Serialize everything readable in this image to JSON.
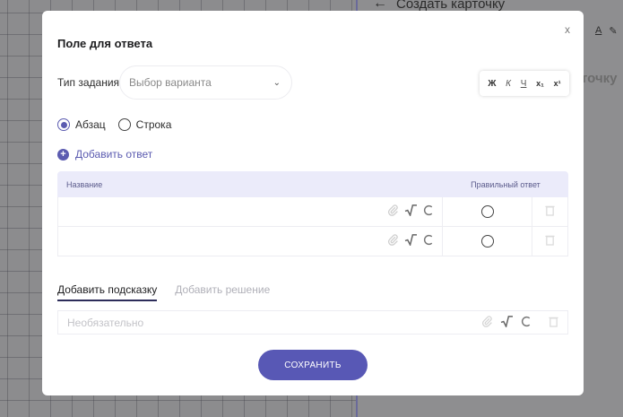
{
  "background": {
    "header_title": "Создать карточку",
    "side_text": "точку",
    "tools": [
      "А",
      "✎"
    ]
  },
  "modal": {
    "title": "Поле для ответа",
    "close_label": "x",
    "task_type_label": "Тип задания",
    "task_type_placeholder": "Выбор варианта",
    "format_toolbar": {
      "bold": "Ж",
      "italic": "К",
      "underline": "Ч",
      "subscript": "x₁",
      "superscript": "x¹"
    },
    "radio_options": [
      {
        "label": "Абзац",
        "checked": true
      },
      {
        "label": "Строка",
        "checked": false
      }
    ],
    "add_answer_label": "Добавить ответ",
    "table": {
      "col_name": "Название",
      "col_correct": "Правильный ответ",
      "rows": [
        {
          "name": "",
          "correct": false
        },
        {
          "name": "",
          "correct": false
        }
      ]
    },
    "tabs": [
      {
        "label": "Добавить подсказку",
        "active": true
      },
      {
        "label": "Добавить решение",
        "active": false
      }
    ],
    "hint_placeholder": "Необязательно",
    "save_label": "СОХРАНИТЬ"
  },
  "colors": {
    "accent": "#5858b5",
    "table_header_bg": "#ebebfa",
    "overlay": "#8c8c8e"
  },
  "icons": [
    "close-icon",
    "chevron-down-icon",
    "plus-icon",
    "attach-icon",
    "sqrt-icon",
    "refresh-icon",
    "trash-icon",
    "back-arrow-icon"
  ]
}
